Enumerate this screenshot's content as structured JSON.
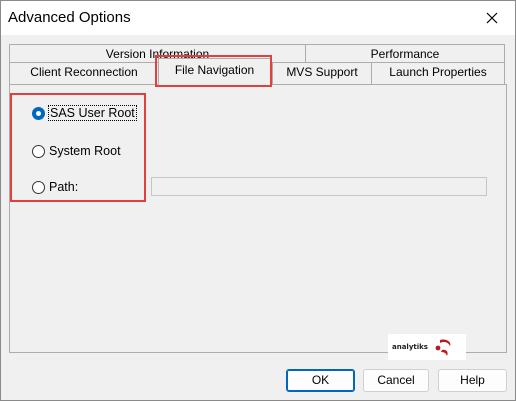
{
  "window": {
    "title": "Advanced Options",
    "close_icon": "close-icon"
  },
  "tabs": {
    "row1": [
      "Version Information",
      "Performance"
    ],
    "row2": [
      "Client Reconnection",
      "File Navigation",
      "MVS Support",
      "Launch Properties"
    ],
    "active": "File Navigation"
  },
  "file_navigation": {
    "options": [
      {
        "label": "SAS User Root",
        "checked": true
      },
      {
        "label": "System Root",
        "checked": false
      },
      {
        "label": "Path:",
        "checked": false
      }
    ],
    "path_value": ""
  },
  "logo": {
    "text": "analytiks"
  },
  "buttons": {
    "ok": "OK",
    "cancel": "Cancel",
    "help": "Help"
  },
  "colors": {
    "highlight": "#e0403e",
    "accent": "#0067c0"
  }
}
